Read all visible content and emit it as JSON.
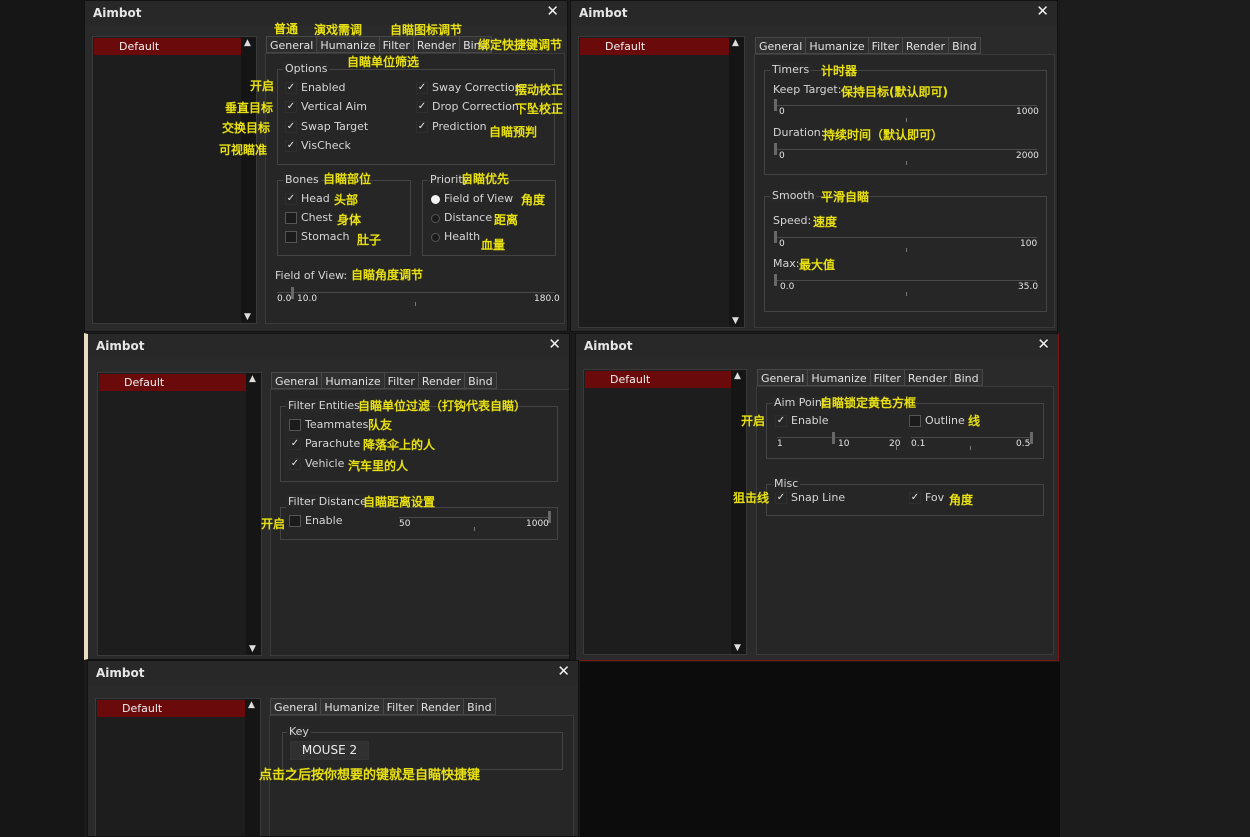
{
  "app_title": "Aimbot",
  "close_glyph": "✕",
  "list_item": "Default",
  "tabs": [
    "General",
    "Humanize",
    "Filter",
    "Render",
    "Bind"
  ],
  "win1": {
    "ann_general": "普通",
    "ann_humanize": "演戏需调",
    "ann_render": "自瞄图标调节",
    "ann_bind": "绑定快捷键调节",
    "ann_filter": "自瞄单位筛选",
    "options_label": "Options",
    "enabled": "Enabled",
    "ann_enabled": "开启",
    "vertical_aim": "Vertical Aim",
    "ann_vertical": "垂直目标",
    "swap_target": "Swap Target",
    "ann_swap": "交换目标",
    "vischeck": "VisCheck",
    "ann_vischeck": "可视瞄准",
    "sway": "Sway Correction",
    "ann_sway": "摆动校正",
    "drop": "Drop Correction",
    "ann_drop": "下坠校正",
    "prediction": "Prediction",
    "ann_prediction": "自瞄预判",
    "bones_label": "Bones",
    "ann_bones": "自瞄部位",
    "head": "Head",
    "ann_head": "头部",
    "chest": "Chest",
    "ann_chest": "身体",
    "stomach": "Stomach",
    "ann_stomach": "肚子",
    "priority_label": "Priority",
    "ann_priority": "自瞄优先",
    "fov_opt": "Field of View",
    "ann_fov_opt": "角度",
    "distance": "Distance",
    "ann_distance": "距离",
    "health": "Health",
    "ann_health": "血量",
    "fov_label": "Field of View:",
    "ann_fov": "自瞄角度调节",
    "fov_min": "0.0",
    "fov_val": "10.0",
    "fov_max": "180.0"
  },
  "win2": {
    "timers_label": "Timers",
    "ann_timers": "计时器",
    "keep_target": "Keep Target:",
    "ann_keep": "保持目标(默认即可)",
    "keep_min": "0",
    "keep_max": "1000",
    "duration": "Duration:",
    "ann_duration": "持续时间（默认即可）",
    "dur_min": "0",
    "dur_max": "2000",
    "smooth_label": "Smooth",
    "ann_smooth": "平滑自瞄",
    "speed": "Speed:",
    "ann_speed": "速度",
    "speed_min": "0",
    "speed_max": "100",
    "max": "Max:",
    "ann_max": "最大值",
    "max_min": "0.0",
    "max_max": "35.0"
  },
  "win3": {
    "filter_entities": "Filter Entities",
    "ann_filter_entities": "自瞄单位过滤（打钩代表自瞄）",
    "teammates": "Teammates",
    "ann_teammates": "队友",
    "parachute": "Parachute",
    "ann_parachute": "降落伞上的人",
    "vehicle": "Vehicle",
    "ann_vehicle": "汽车里的人",
    "filter_distance": "Filter Distance",
    "ann_filter_distance": "自瞄距离设置",
    "enable": "Enable",
    "ann_enable": "开启",
    "dist_val": "50",
    "dist_max": "1000"
  },
  "win4": {
    "aim_point": "Aim Point",
    "ann_aim_point": "自瞄锁定黄色方框",
    "enable": "Enable",
    "ann_enable": "开启",
    "outline": "Outline",
    "ann_outline": "线",
    "s1_min": "1",
    "s1_val": "10",
    "s1_max": "20",
    "s2_min": "0.1",
    "s2_max": "0.5",
    "misc": "Misc",
    "snap_line": "Snap Line",
    "ann_snap": "狙击线",
    "fov": "Fov",
    "ann_fov": "角度"
  },
  "win5": {
    "key_label": "Key",
    "key_value": "MOUSE 2",
    "ann_key": "点击之后按你想要的键就是自瞄快捷键"
  },
  "colors": {
    "selected": "#6b0a0a",
    "annotation": "#e8e010",
    "window": "#2a2a2a"
  }
}
